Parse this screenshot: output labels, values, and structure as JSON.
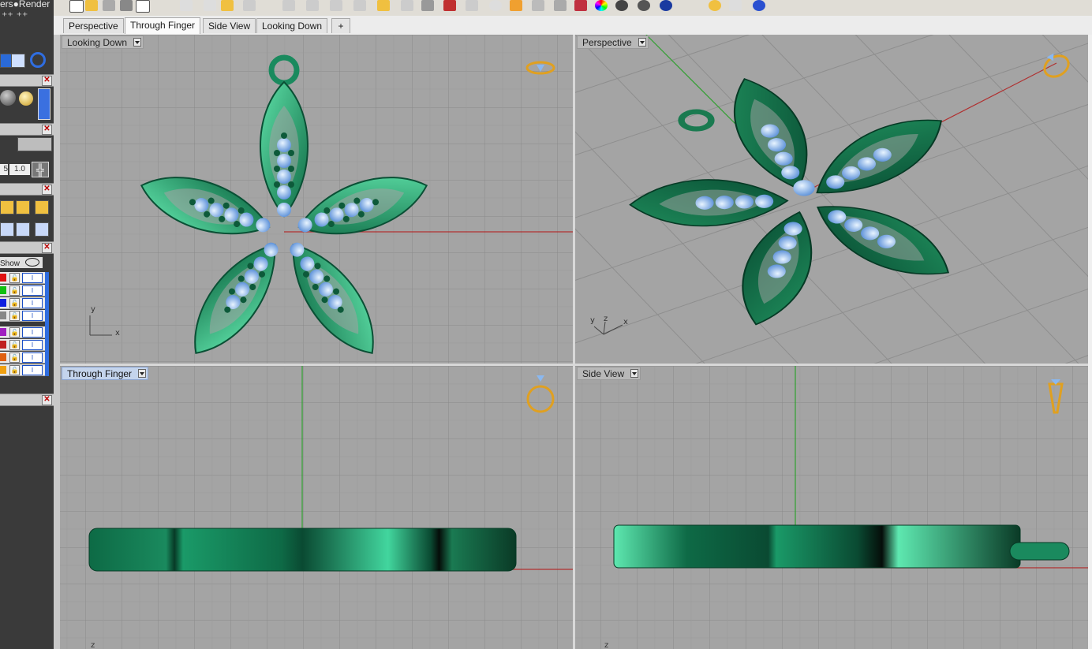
{
  "app": {
    "left_panel_text": "ers●Render"
  },
  "tabs": [
    {
      "label": "Perspective",
      "active": false
    },
    {
      "label": "Through Finger",
      "active": true
    },
    {
      "label": "Side View",
      "active": false
    },
    {
      "label": "Looking Down",
      "active": false
    },
    {
      "label": "+",
      "active": false
    }
  ],
  "left_panel": {
    "values": {
      "a": "5",
      "b": "1.0"
    },
    "show_label": "Show",
    "layers": [
      {
        "color": "#e01010"
      },
      {
        "color": "#10c010"
      },
      {
        "color": "#1020e0"
      },
      {
        "color": "#888888"
      },
      {
        "color": "#a020c0"
      },
      {
        "color": "#c02020"
      },
      {
        "color": "#e06010"
      },
      {
        "color": "#f0a010"
      }
    ]
  },
  "viewports": {
    "top_left": {
      "label": "Looking Down",
      "axis_x": "x",
      "axis_y": "y",
      "active": false
    },
    "top_right": {
      "label": "Perspective",
      "axis_x": "x",
      "axis_y": "y",
      "axis_z": "z",
      "active": false
    },
    "bottom_left": {
      "label": "Through Finger",
      "axis_z": "z",
      "active": true
    },
    "bottom_right": {
      "label": "Side View",
      "axis_z": "z",
      "active": false
    }
  },
  "colors": {
    "model_green": "#1a8a5e",
    "gem_blue": "#8ab8f0",
    "grid_bg": "#a4a4a4",
    "axis_red": "#b03030",
    "axis_green": "#30a030",
    "ring_gold": "#e0a020"
  }
}
